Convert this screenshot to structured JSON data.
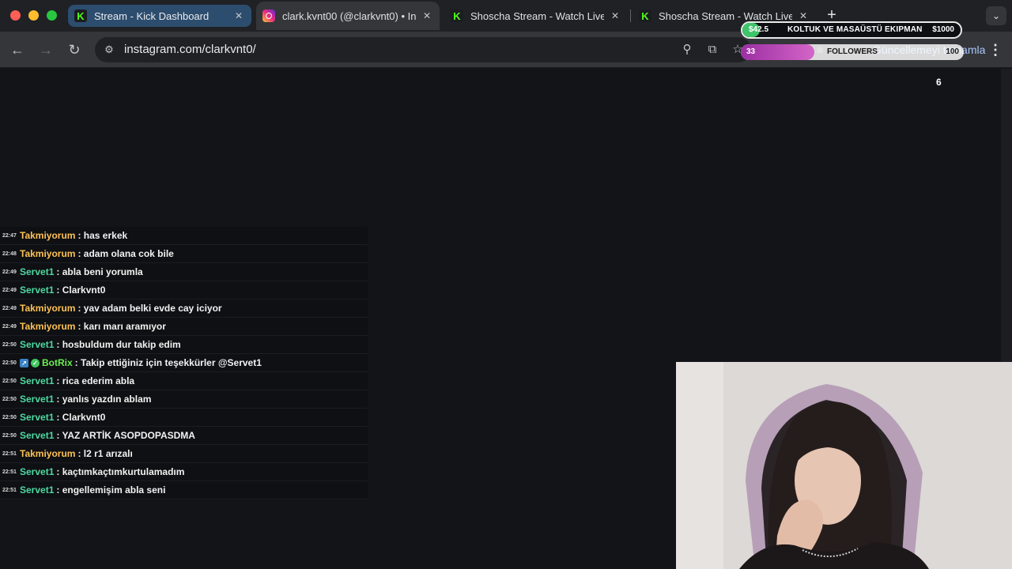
{
  "browser": {
    "tabs": [
      {
        "title": "Stream - Kick Dashboard",
        "favicon": "kick-icon",
        "active": false
      },
      {
        "title": "clark.kvnt00 (@clarkvnt0) • In",
        "favicon": "instagram-icon",
        "active": true
      },
      {
        "title": "Shoscha Stream - Watch Live",
        "favicon": "kick-icon",
        "active": false
      },
      {
        "title": "Shoscha Stream - Watch Live",
        "favicon": "kick-icon",
        "active": false
      }
    ],
    "url": "instagram.com/clarkvnt0/",
    "update_button": "Güncellemeyi tamamla",
    "accent_color": "#a8c7fa"
  },
  "overlay": {
    "goal": {
      "current": "$42.5",
      "title": "KOLTUK VE MASAÜSTÜ EKIPMAN",
      "target": "$1000",
      "progress_percent": 4.25,
      "color": "#3fc46a"
    },
    "followers": {
      "current": "33",
      "title": "FOLLOWERS",
      "target": "100",
      "progress_percent": 33,
      "color": "#b84bb6"
    },
    "counter": "6"
  },
  "chat": {
    "messages": [
      {
        "time": "22:47",
        "user": "Takmiyorum",
        "text": ": has erkek"
      },
      {
        "time": "22:48",
        "user": "Takmiyorum",
        "text": ": adam olana cok bile"
      },
      {
        "time": "22:49",
        "user": "Servet1",
        "text": ": abla beni yorumla"
      },
      {
        "time": "22:49",
        "user": "Servet1",
        "text": ": Clarkvnt0"
      },
      {
        "time": "22:49",
        "user": "Takmiyorum",
        "text": ": yav adam belki evde cay iciyor"
      },
      {
        "time": "22:49",
        "user": "Takmiyorum",
        "text": ": karı marı aramıyor"
      },
      {
        "time": "22:50",
        "user": "Servet1",
        "text": ": hosbuldum dur takip edim"
      },
      {
        "time": "22:50",
        "user": "BotRix",
        "text": ": Takip ettiğiniz için teşekkürler @Servet1"
      },
      {
        "time": "22:50",
        "user": "Servet1",
        "text": ": rica ederim abla"
      },
      {
        "time": "22:50",
        "user": "Servet1",
        "text": ": yanlıs yazdın ablam"
      },
      {
        "time": "22:50",
        "user": "Servet1",
        "text": ": Clarkvnt0"
      },
      {
        "time": "22:50",
        "user": "Servet1",
        "text": ": YAZ ARTİK ASOPDOPASDMA"
      },
      {
        "time": "22:51",
        "user": "Takmiyorum",
        "text": ": l2 r1 arızalı"
      },
      {
        "time": "22:51",
        "user": "Servet1",
        "text": ": kaçtımkaçtımkurtulamadım"
      },
      {
        "time": "22:51",
        "user": "Servet1",
        "text": ": engellemişim abla seni"
      }
    ],
    "user_colors": {
      "Takmiyorum": "#ffc155",
      "Servet1": "#4fd9a2",
      "BotRix": "#6bee52"
    }
  }
}
